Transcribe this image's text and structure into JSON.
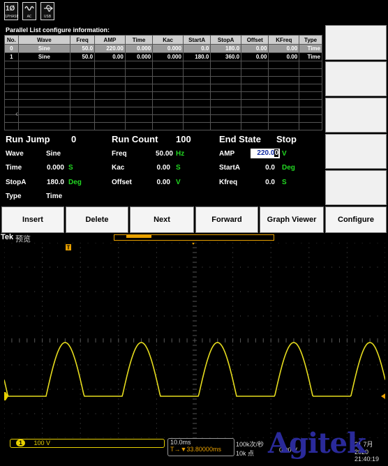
{
  "status_bar": {
    "icons": [
      {
        "name": "phase-icon",
        "label": "1PHASE",
        "big": "1Ø"
      },
      {
        "name": "ac-icon",
        "label": "AC"
      },
      {
        "name": "usb-icon",
        "label": "USB"
      }
    ]
  },
  "list": {
    "title": "Parallel List configure information:",
    "columns": [
      "No.",
      "Wave",
      "Freq",
      "AMP",
      "Time",
      "Kac",
      "StartA",
      "StopA",
      "Offset",
      "KFreq",
      "Type"
    ],
    "rows": [
      [
        "0",
        "Sine",
        "50.0",
        "220.00",
        "0.000",
        "0.000",
        "0.0",
        "180.0",
        "0.00",
        "0.00",
        "Time"
      ],
      [
        "1",
        "Sine",
        "50.0",
        "0.00",
        "0.000",
        "0.000",
        "180.0",
        "360.0",
        "0.00",
        "0.00",
        "Time"
      ]
    ],
    "selected_row": 0
  },
  "params": {
    "run_jump_label": "Run Jump",
    "run_jump_value": "0",
    "run_count_label": "Run Count",
    "run_count_value": "100",
    "end_state_label": "End State",
    "end_state_value": "Stop",
    "wave_label": "Wave",
    "wave_value": "Sine",
    "freq_label": "Freq",
    "freq_value": "50.00",
    "freq_unit": "Hz",
    "amp_label": "AMP",
    "amp_value_main": "220.0",
    "amp_value_cursor": "0",
    "amp_unit": "V",
    "time_label": "Time",
    "time_value": "0.000",
    "time_unit": "S",
    "kac_label": "Kac",
    "kac_value": "0.00",
    "kac_unit": "S",
    "starta_label": "StartA",
    "starta_value": "0.0",
    "starta_unit": "Deg",
    "stopa_label": "StopA",
    "stopa_value": "180.0",
    "stopa_unit": "Deg",
    "offset_label": "Offset",
    "offset_value": "0.00",
    "offset_unit": "V",
    "kfreq_label": "Kfreq",
    "kfreq_value": "0.0",
    "kfreq_unit": "S",
    "type_label": "Type",
    "type_value": "Time"
  },
  "buttons": {
    "insert": "Insert",
    "delete": "Delete",
    "next": "Next",
    "forward": "Forward",
    "graph_viewer": "Graph Viewer",
    "configure": "Configure"
  },
  "scope": {
    "brand": "Tek",
    "mode": "预览",
    "channel_tag": "1",
    "channel_scale": "100 V",
    "time_scale": "10.0ms",
    "trigger_offset": "T→▼33.80000ms",
    "sample_rate": "100k次/秒",
    "record_length": "10k 点",
    "trigger_level": "0.00 V",
    "date_line1": "21 7月 2020",
    "date_line2": "21:40:19",
    "watermark": "Agitek",
    "waveform": {
      "period_ms": 20,
      "half_wave_rectified": true,
      "amplitude_divisions": 2.2,
      "horizontal_scale_ms_per_div": 10,
      "vertical_scale_v_per_div": 100
    },
    "colors": {
      "trace": "#e6dc1e",
      "trigger": "#e8a000",
      "grid": "#555555"
    }
  }
}
